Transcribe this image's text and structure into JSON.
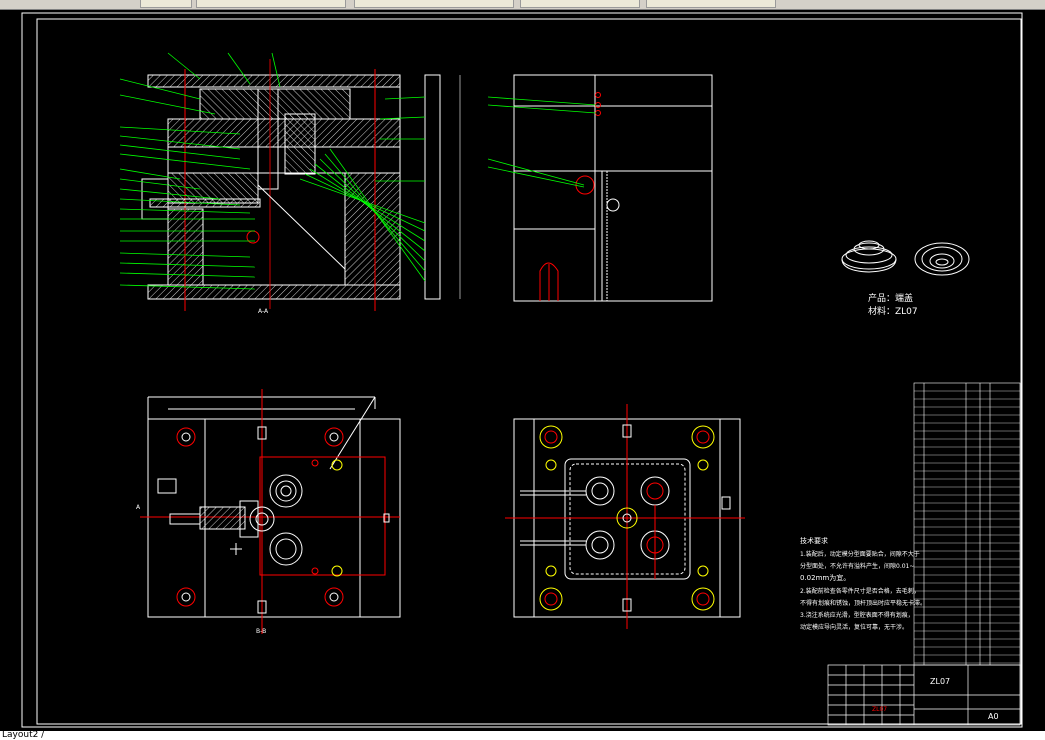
{
  "toolbar": {
    "tabs": [
      "",
      "",
      "",
      "",
      "",
      ""
    ]
  },
  "drawing": {
    "section_aa": "A-A",
    "section_bb": "B-B",
    "section_mark": "A",
    "product_label": "产品：端盖",
    "material_label": "材料：ZL07",
    "tech_title": "技术要求",
    "tech_notes": [
      "1.装配后，动定模分型面要贴合，间隙不大于",
      "分型面处，不允许有溢料产生，间隙0.01~",
      "0.02mm为宜。",
      "2.装配前检查各零件尺寸是否合格，去毛刺，",
      "不得有划痕和锈蚀，顶杆顶出时应平稳无卡滞。",
      "3.浇注系统应光滑，型腔表面不得有划痕，",
      "动定模应导向灵活，复位可靠，无干涉。"
    ],
    "title_block_name": "ZL07",
    "title_block_size": "A0",
    "title_block_red": "ZL07"
  },
  "colors": {
    "frame": "#ffffff",
    "leader": "#00ff00",
    "hatch": "#ffffff",
    "centerline": "#ff0000",
    "accent": "#ffff00"
  },
  "status": {
    "layout_tab": "Layout2 /"
  }
}
